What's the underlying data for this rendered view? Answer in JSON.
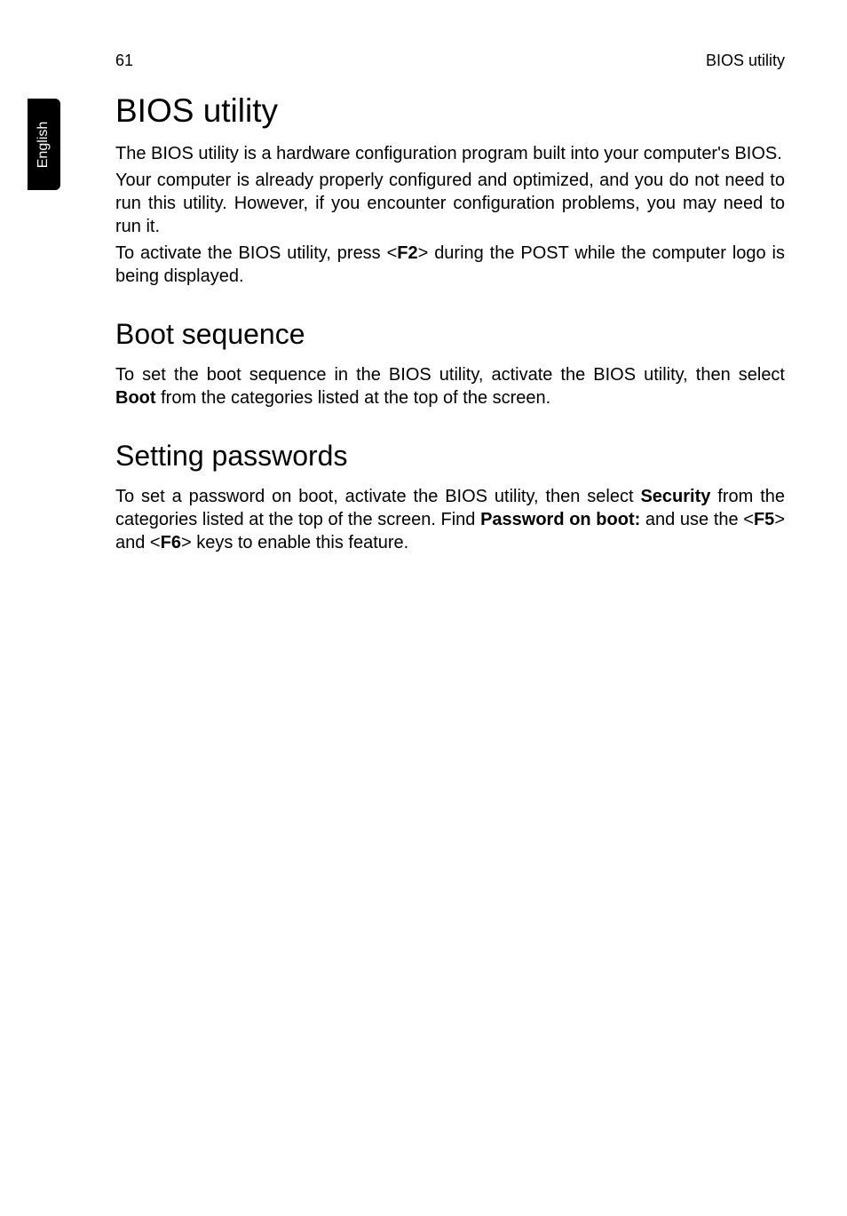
{
  "header": {
    "page_number": "61",
    "right_label": "BIOS utility"
  },
  "side_tab": {
    "label": "English"
  },
  "sections": {
    "title": "BIOS utility",
    "p1": "The BIOS utility is a hardware configuration program built into your computer's BIOS.",
    "p2": "Your computer is already properly configured and optimized, and you do not need to run this utility. However, if you encounter configuration problems, you may need to run it.",
    "p3_a": "To activate the BIOS utility, press <",
    "p3_b": "F2",
    "p3_c": "> during the POST while the computer logo is being displayed.",
    "boot_title": "Boot sequence",
    "boot_p1_a": "To set the boot sequence in the BIOS utility, activate the BIOS utility, then select ",
    "boot_p1_b": "Boot",
    "boot_p1_c": " from the categories listed at the top of the screen.",
    "pwd_title": "Setting passwords",
    "pwd_p1_a": "To set a password on boot, activate the BIOS utility, then select ",
    "pwd_p1_b": "Security",
    "pwd_p1_c": " from the categories listed at the top of the screen. Find ",
    "pwd_p1_d": "Password on boot:",
    "pwd_p1_e": " and use the <",
    "pwd_p1_f": "F5",
    "pwd_p1_g": "> and <",
    "pwd_p1_h": "F6",
    "pwd_p1_i": "> keys to enable this feature."
  }
}
